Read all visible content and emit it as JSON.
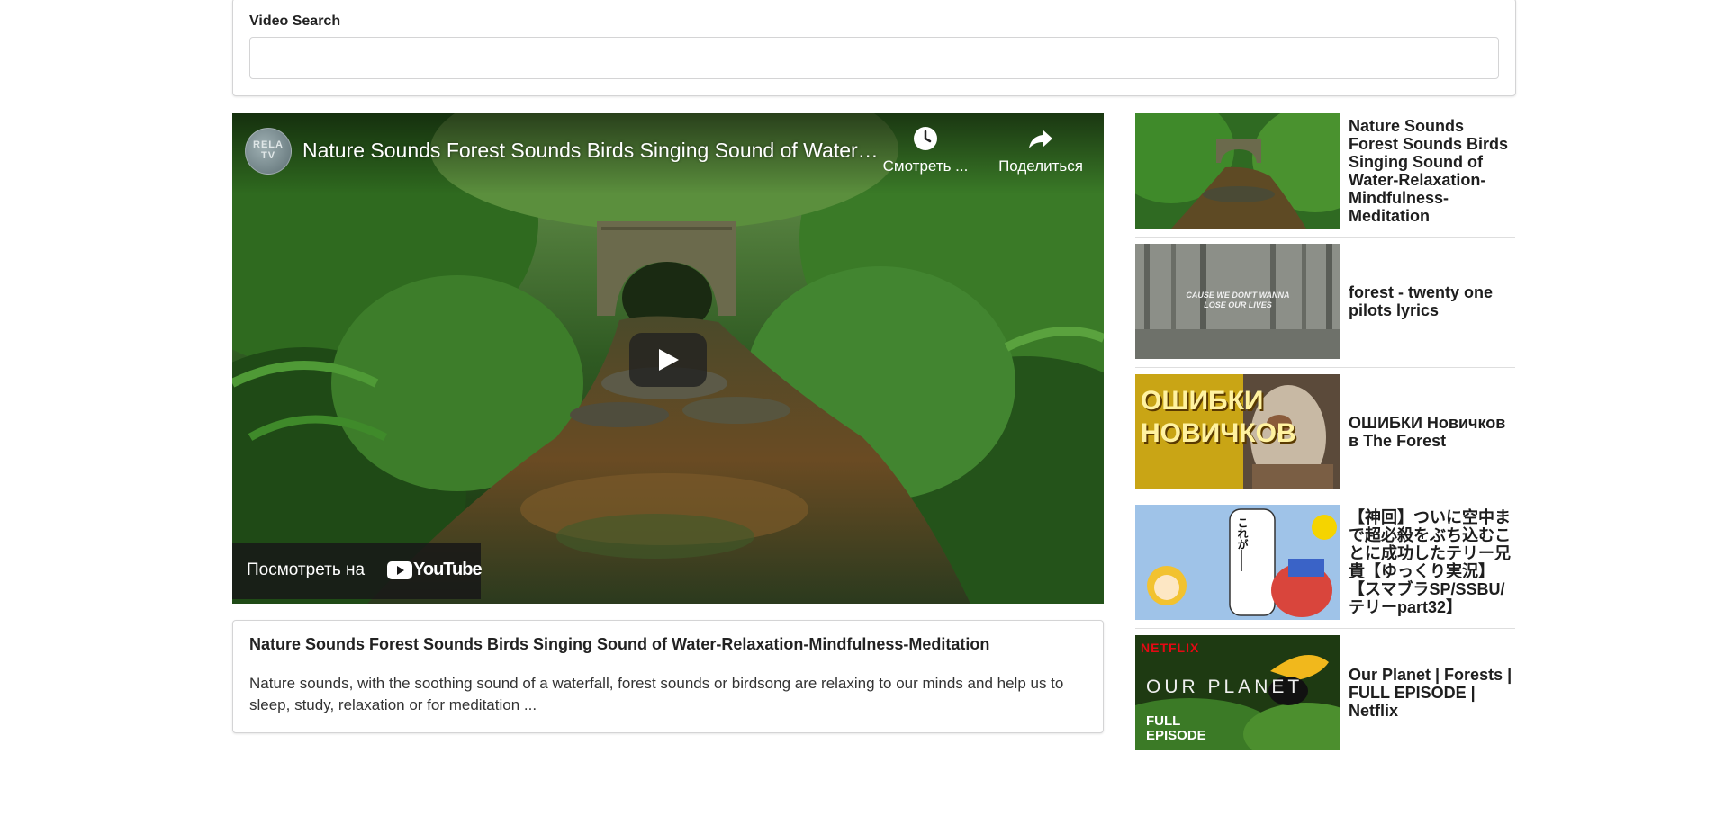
{
  "search": {
    "label": "Video Search",
    "value": "",
    "placeholder": ""
  },
  "player": {
    "channel_initials": "RELA TV",
    "title": "Nature Sounds Forest Sounds Birds Singing Sound of Water-Relaxation-Mindfulness-Meditation",
    "watch_later_label": "Смотреть ...",
    "share_label": "Поделиться",
    "watch_on_label": "Посмотреть на",
    "youtube_label": "YouTube"
  },
  "selected": {
    "title": "Nature Sounds Forest Sounds Birds Singing Sound of Water-Relaxation-Mindfulness-Meditation",
    "description": "Nature sounds, with the soothing sound of a waterfall, forest sounds or birdsong are relaxing to our minds and help us to sleep, study, relaxation or for meditation ..."
  },
  "videos": [
    {
      "title": "Nature Sounds Forest Sounds Birds Singing Sound of Water-Relaxation-Mindfulness-Meditation"
    },
    {
      "title": "forest - twenty one pilots lyrics",
      "thumb_text": "CAUSE WE DON'T WANNA LOSE OUR LIVES"
    },
    {
      "title": "ОШИБКИ Новичков в The Forest",
      "thumb_text": "ОШИБКИ НОВИЧКОВ"
    },
    {
      "title": "【神回】ついに空中まで超必殺をぶち込むことに成功したテリー兄貴【ゆっくり実況】【スマブラSP/SSBU/テリーpart32】",
      "thumb_text": "これが――"
    },
    {
      "title": "Our Planet | Forests | FULL EPISODE | Netflix",
      "thumb_text": "NETFLIX",
      "thumb_subtitle": "OUR PLANET",
      "thumb_badge": "FULL EPISODE"
    }
  ],
  "colors": {
    "border": "#d4d4d5",
    "foliage": "#2e6b22",
    "netflix_red": "#e50914"
  }
}
